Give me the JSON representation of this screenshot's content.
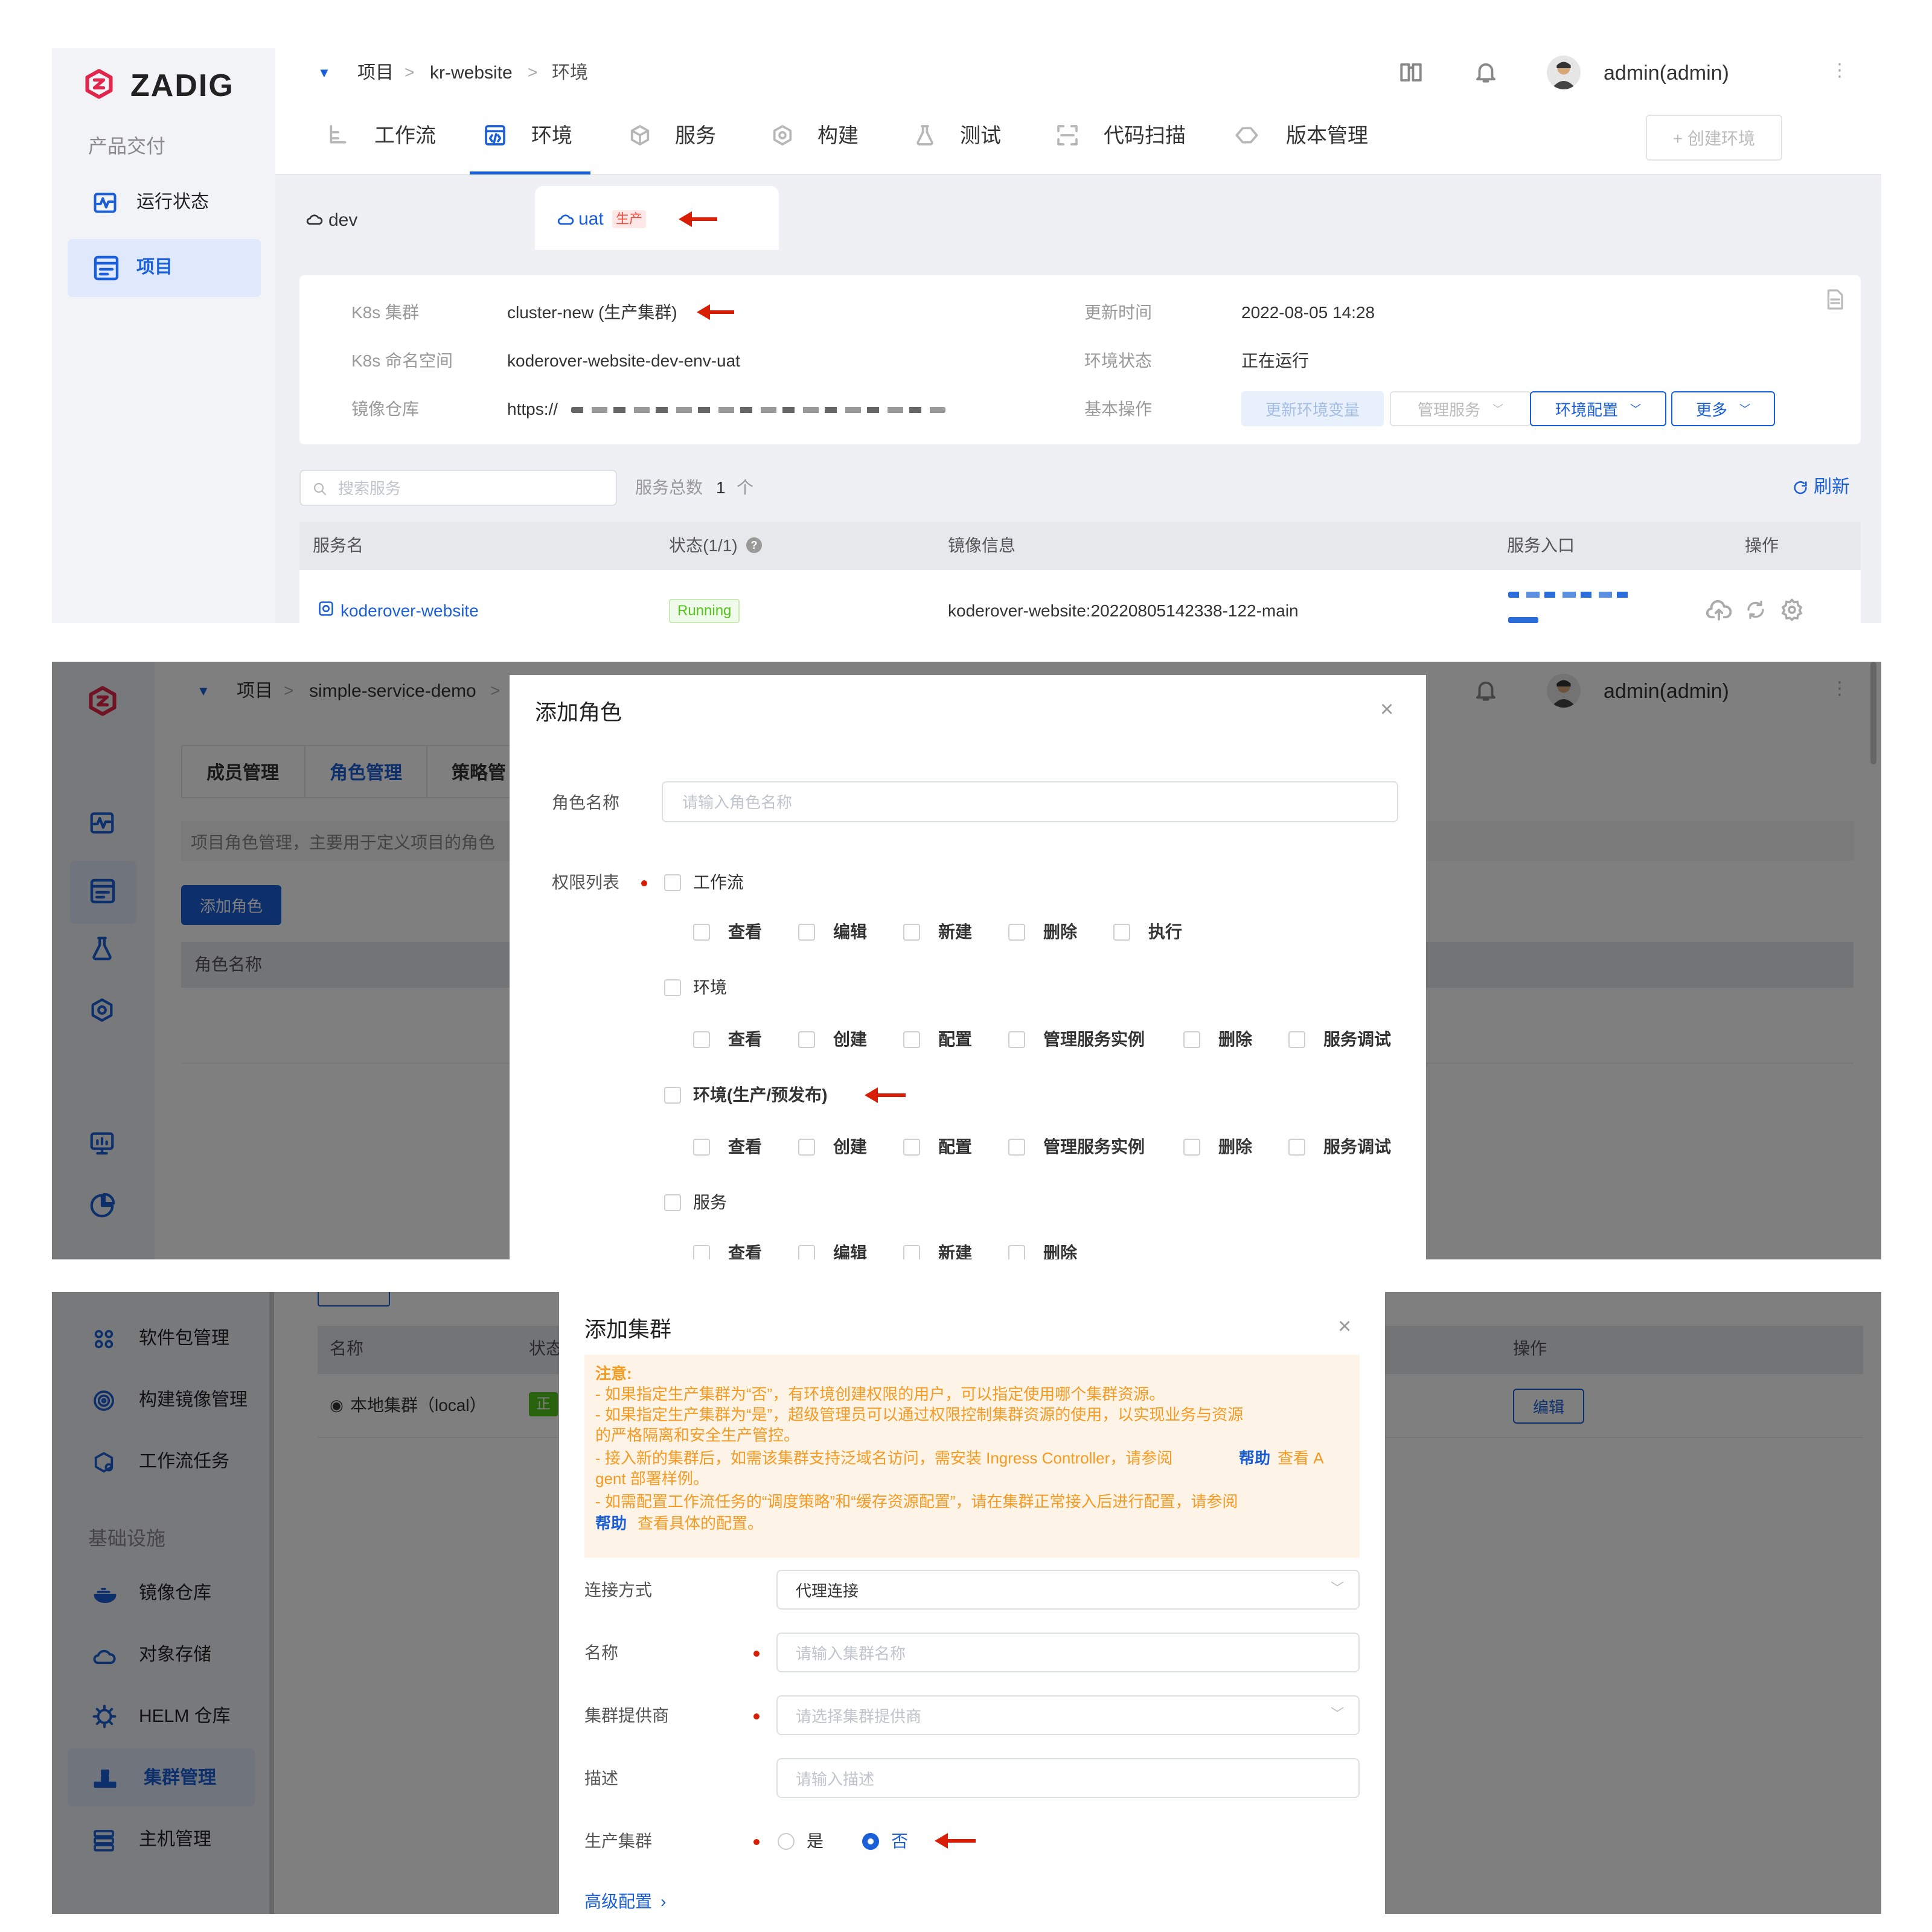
{
  "panel1": {
    "brand": "ZADIG",
    "sidebar": {
      "section": "产品交付",
      "items": [
        {
          "label": "运行状态"
        },
        {
          "label": "项目"
        }
      ]
    },
    "breadcrumb": {
      "root": "项目",
      "project": "kr-website",
      "current": "环境"
    },
    "user": "admin(admin)",
    "tabs": [
      "工作流",
      "环境",
      "服务",
      "构建",
      "测试",
      "代码扫描",
      "版本管理"
    ],
    "create_env": "+ 创建环境",
    "env_tabs": [
      {
        "label": "dev"
      },
      {
        "label": "uat",
        "badge": "生产"
      }
    ],
    "info": {
      "cluster_label": "K8s 集群",
      "cluster_value": "cluster-new (生产集群)",
      "ns_label": "K8s 命名空间",
      "ns_value": "koderover-website-dev-env-uat",
      "repo_label": "镜像仓库",
      "repo_value": "https://",
      "updated_label": "更新时间",
      "updated_value": "2022-08-05 14:28",
      "status_label": "环境状态",
      "status_value": "正在运行",
      "ops_label": "基本操作",
      "ops": [
        "更新环境变量",
        "管理服务",
        "环境配置",
        "更多"
      ]
    },
    "search_placeholder": "搜索服务",
    "service_count_label": "服务总数",
    "service_count": "1",
    "service_count_unit": "个",
    "refresh": "刷新",
    "table": {
      "headers": [
        "服务名",
        "状态(1/1)",
        "镜像信息",
        "服务入口",
        "操作"
      ],
      "rows": [
        {
          "name": "koderover-website",
          "status": "Running",
          "image": "koderover-website:20220805142338-122-main"
        }
      ]
    }
  },
  "panel2": {
    "breadcrumb": {
      "root": "项目",
      "project": "simple-service-demo"
    },
    "user": "admin(admin)",
    "tabs": [
      "成员管理",
      "角色管理",
      "策略管"
    ],
    "desc": "项目角色管理，主要用于定义项目的角色",
    "add_button": "添加角色",
    "table_header": "角色名称",
    "dialog": {
      "title": "添加角色",
      "name_label": "角色名称",
      "name_placeholder": "请输入角色名称",
      "perm_label": "权限列表",
      "groups": [
        {
          "name": "工作流",
          "perms": [
            "查看",
            "编辑",
            "新建",
            "删除",
            "执行"
          ]
        },
        {
          "name": "环境",
          "perms": [
            "查看",
            "创建",
            "配置",
            "管理服务实例",
            "删除",
            "服务调试"
          ]
        },
        {
          "name": "环境(生产/预发布)",
          "perms": [
            "查看",
            "创建",
            "配置",
            "管理服务实例",
            "删除",
            "服务调试"
          ]
        },
        {
          "name": "服务",
          "perms": [
            "查看",
            "编辑",
            "新建",
            "删除"
          ]
        }
      ]
    }
  },
  "panel3": {
    "sidebar": {
      "items": [
        "软件包管理",
        "构建镜像管理",
        "工作流任务"
      ],
      "section": "基础设施",
      "infra": [
        "镜像仓库",
        "对象存储",
        "HELM 仓库",
        "集群管理",
        "主机管理"
      ]
    },
    "table": {
      "headers": [
        "名称",
        "状态",
        "操作"
      ],
      "row_name": "本地集群（local）",
      "row_status": "正",
      "edit": "编辑"
    },
    "dialog": {
      "title": "添加集群",
      "note_title": "注意:",
      "notes": [
        "- 如果指定生产集群为“否”，有环境创建权限的用户，可以指定使用哪个集群资源。",
        "- 如果指定生产集群为“是”，超级管理员可以通过权限控制集群资源的使用，以实现业务与资源",
        "的严格隔离和安全生产管控。",
        "- 接入新的集群后，如需该集群支持泛域名访问，需安装 Ingress Controller，请参阅",
        "帮助",
        "查看 A",
        "gent 部署样例。",
        "- 如需配置工作流任务的“调度策略”和“缓存资源配置”，请在集群正常接入后进行配置，请参阅",
        "帮助",
        "查看具体的配置。"
      ],
      "conn_label": "连接方式",
      "conn_value": "代理连接",
      "name_label": "名称",
      "name_placeholder": "请输入集群名称",
      "provider_label": "集群提供商",
      "provider_placeholder": "请选择集群提供商",
      "desc_label": "描述",
      "desc_placeholder": "请输入描述",
      "prod_label": "生产集群",
      "yes": "是",
      "no": "否",
      "advanced": "高级配置"
    }
  },
  "colors": {
    "primary": "#0066ff",
    "red": "#d81e06",
    "note_text": "#f59a23",
    "note_bg": "#fdf3e6",
    "green": "#52c41a"
  }
}
